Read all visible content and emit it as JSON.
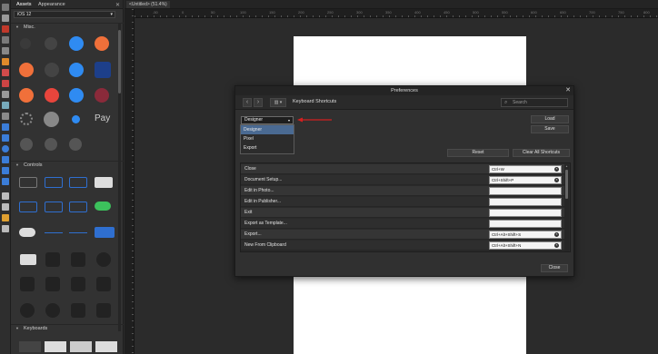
{
  "assets_panel": {
    "tabs": [
      "Assets",
      "Appearance"
    ],
    "selector": "iOS 12",
    "sections": [
      "Misc.",
      "Controls",
      "Keyboards"
    ]
  },
  "document": {
    "tab_title": "<Untitled> (51.4%)"
  },
  "ruler_numbers": [
    "-50",
    "0",
    "50",
    "100",
    "150",
    "200",
    "250",
    "300",
    "350",
    "400",
    "450",
    "500",
    "550",
    "600",
    "650",
    "700",
    "750",
    "800"
  ],
  "preferences": {
    "title": "Preferences",
    "close": "✕",
    "breadcrumb": "Keyboard Shortcuts",
    "search_placeholder": "Search",
    "preset_value": "Designer",
    "preset_options": [
      "Designer",
      "Pixel",
      "Export"
    ],
    "buttons": {
      "load": "Load",
      "save": "Save",
      "reset": "Reset",
      "clear_all": "Clear All Shortcuts",
      "close": "Close"
    },
    "shortcuts": [
      {
        "command": "Close",
        "key": "Ctrl+W"
      },
      {
        "command": "Document Setup...",
        "key": "Ctrl+Shift+P"
      },
      {
        "command": "Edit in Photo...",
        "key": ""
      },
      {
        "command": "Edit in Publisher...",
        "key": ""
      },
      {
        "command": "Exit",
        "key": ""
      },
      {
        "command": "Export as Template...",
        "key": ""
      },
      {
        "command": "Export...",
        "key": "Ctrl+Alt+Shift+S"
      },
      {
        "command": "New From Clipboard",
        "key": "Ctrl+Alt+Shift+N"
      }
    ]
  },
  "colors": {
    "accent_selection": "#4a6a92",
    "annotation_arrow": "#d42020",
    "page": "#ffffff"
  }
}
